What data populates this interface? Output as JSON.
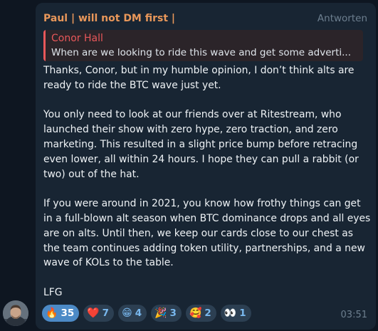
{
  "message": {
    "sender": "Paul | will not DM first |",
    "reply_action": "Antworten",
    "quoted": {
      "author": "Conor Hall",
      "text": "When are we looking to ride this wave and get some adverti..."
    },
    "paragraphs": [
      "Thanks, Conor, but in my humble opinion, I don’t think alts are ready to ride the BTC wave just yet.",
      "You only need to look at our friends over at Ritestream, who launched their show with zero hype, zero traction, and zero marketing. This resulted in a slight price bump before retracing even lower, all within 24 hours. I hope they can pull a rabbit (or two) out of the hat.",
      "If you were around in 2021, you know how frothy things can get in a full-blown alt season when BTC dominance drops and all eyes are on alts. Until then, we keep our cards close to our chest as the team continues adding token utility, partnerships, and a new wave of KOLs to the table.",
      "LFG"
    ],
    "timestamp": "03:51",
    "reactions": [
      {
        "emoji": "🔥",
        "icon": "fire-icon",
        "count": "35",
        "active": true
      },
      {
        "emoji": "❤️",
        "icon": "heart-icon",
        "count": "7",
        "active": false
      },
      {
        "emoji": "😁",
        "icon": "grin-icon",
        "count": "4",
        "active": false
      },
      {
        "emoji": "🎉",
        "icon": "party-popper-icon",
        "count": "3",
        "active": false
      },
      {
        "emoji": "🥰",
        "icon": "smiling-face-with-hearts-icon",
        "count": "2",
        "active": false
      },
      {
        "emoji": "👀",
        "icon": "eyes-icon",
        "count": "1",
        "active": false
      }
    ]
  },
  "colors": {
    "background": "#0e1621",
    "bubble": "#182533",
    "sender_name": "#e8975a",
    "quote_accent": "#e8575a",
    "reaction_active": "#4c8ac6",
    "reaction_inactive": "#2c3f52",
    "muted_text": "#6d7f8f"
  }
}
